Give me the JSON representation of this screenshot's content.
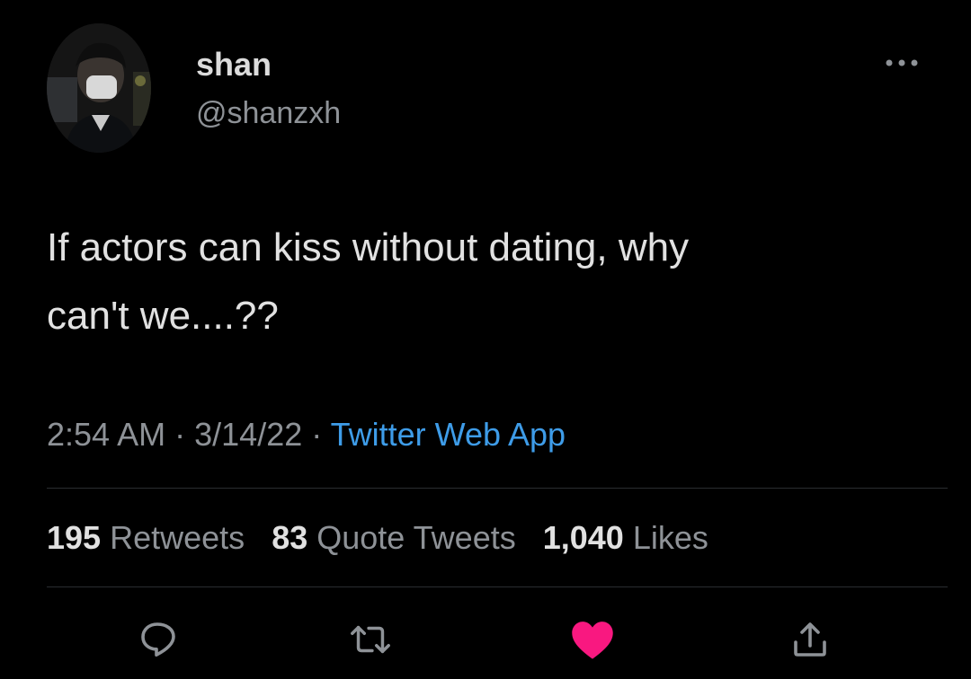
{
  "tweet": {
    "author": {
      "display_name": "shan",
      "handle": "@shanzxh"
    },
    "text_line1": "If actors can kiss without dating, why",
    "text_line2": "can't we....??",
    "time": "2:54 AM",
    "date": "3/14/22",
    "separator": "·",
    "source": "Twitter Web App"
  },
  "stats": {
    "retweets_count": "195",
    "retweets_label": "Retweets",
    "quotes_count": "83",
    "quotes_label": "Quote Tweets",
    "likes_count": "1,040",
    "likes_label": "Likes"
  },
  "actions": {
    "icons": [
      "reply-icon",
      "retweet-icon",
      "like-icon",
      "share-icon"
    ],
    "liked": true,
    "like_color": "#f91880",
    "icon_color": "#8e9297"
  },
  "colors": {
    "background": "#000000",
    "link": "#3e9ce8",
    "secondary_text": "#8e9297"
  }
}
